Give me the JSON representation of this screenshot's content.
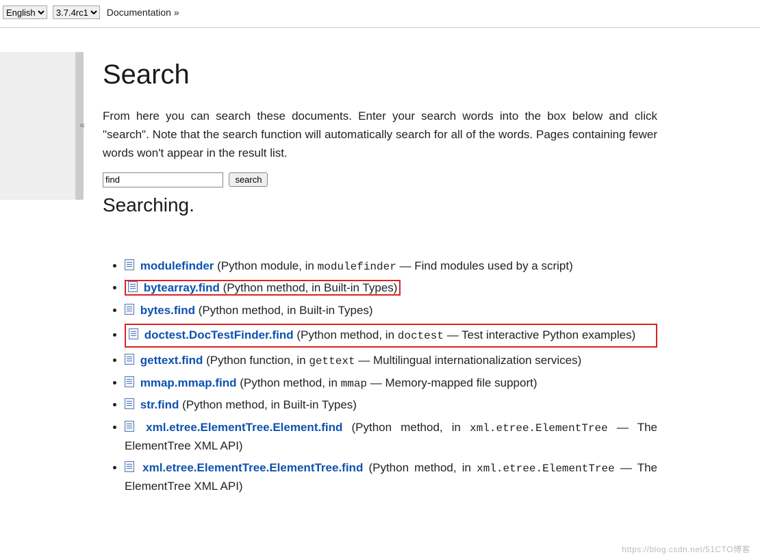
{
  "header": {
    "language_selected": "English",
    "version_selected": "3.7.4rc1",
    "doc_link": "Documentation »"
  },
  "sidebar": {
    "collapse_glyph": "«"
  },
  "page": {
    "title": "Search",
    "intro": "From here you can search these documents. Enter your search words into the box below and click \"search\". Note that the search function will automatically search for all of the words. Pages containing fewer words won't appear in the result list.",
    "search_value": "find",
    "search_button": "search",
    "status": "Searching."
  },
  "results": [
    {
      "title": "modulefinder",
      "desc_prefix": " (Python module, in ",
      "desc_code": "modulefinder",
      "desc_suffix": " — Find modules used by a script)",
      "highlight": "none"
    },
    {
      "title": "bytearray.find",
      "desc_prefix": " (Python method, in Built-in Types)",
      "desc_code": "",
      "desc_suffix": "",
      "highlight": "inline"
    },
    {
      "title": "bytes.find",
      "desc_prefix": " (Python method, in Built-in Types)",
      "desc_code": "",
      "desc_suffix": "",
      "highlight": "none"
    },
    {
      "title": "doctest.DocTestFinder.find",
      "desc_prefix": " (Python method, in ",
      "desc_code": "doctest",
      "desc_suffix": " — Test interactive Python examples)",
      "highlight": "block"
    },
    {
      "title": "gettext.find",
      "desc_prefix": " (Python function, in ",
      "desc_code": "gettext",
      "desc_suffix": " — Multilingual internationalization services)",
      "highlight": "none"
    },
    {
      "title": "mmap.mmap.find",
      "desc_prefix": " (Python method, in ",
      "desc_code": "mmap",
      "desc_suffix": " — Memory-mapped file support)",
      "highlight": "none"
    },
    {
      "title": "str.find",
      "desc_prefix": " (Python method, in Built-in Types)",
      "desc_code": "",
      "desc_suffix": "",
      "highlight": "none"
    },
    {
      "title": "xml.etree.ElementTree.Element.find",
      "desc_prefix": " (Python method, in ",
      "desc_code": "xml.etree.ElementTree",
      "desc_suffix": " — The ElementTree XML API)",
      "highlight": "none"
    },
    {
      "title": "xml.etree.ElementTree.ElementTree.find",
      "desc_prefix": " (Python method, in ",
      "desc_code": "xml.etree.ElementTree",
      "desc_suffix": " — The ElementTree XML API)",
      "highlight": "none"
    }
  ],
  "watermark": "https://blog.csdn.net/51CTO博客"
}
